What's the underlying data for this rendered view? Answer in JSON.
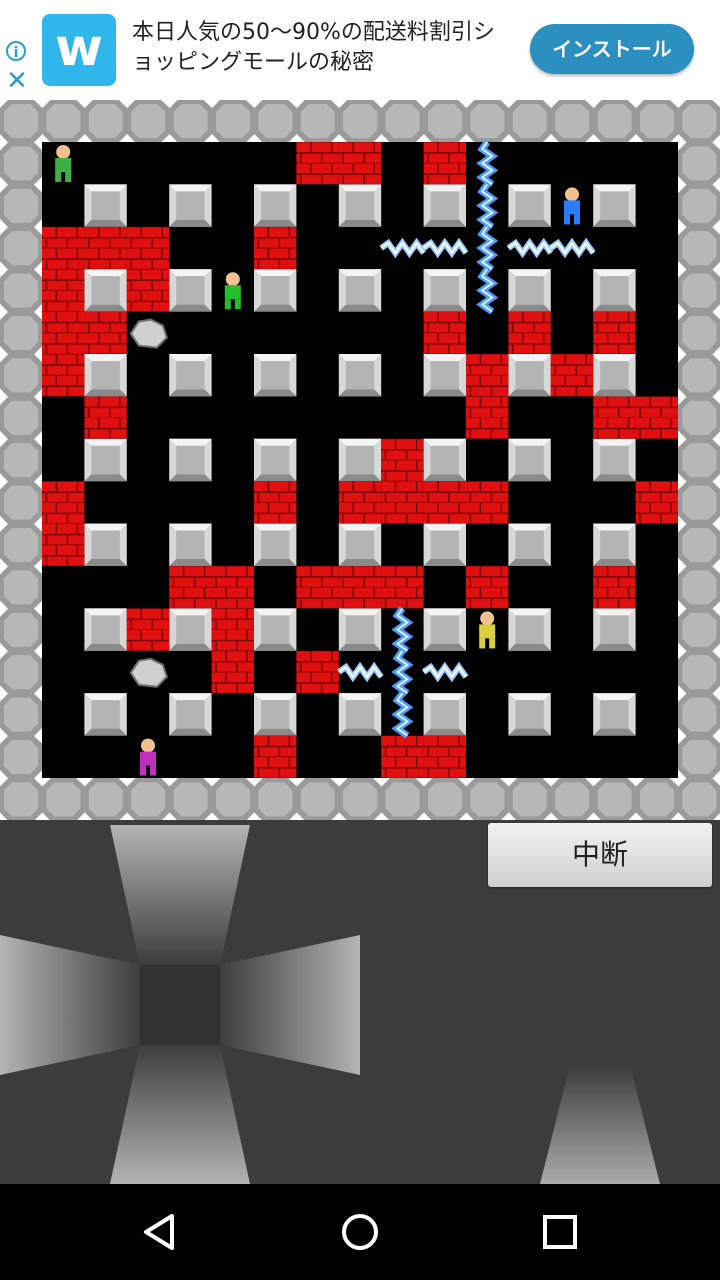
{
  "ad": {
    "text": "本日人気の50〜90%の配送料割引ショッピングモールの秘密",
    "install_label": "インストール",
    "logo_letter": "w",
    "info_glyph": "i",
    "close_glyph": "✕",
    "accent": "#2b8fbf"
  },
  "controls": {
    "pause_label": "中断"
  },
  "game": {
    "grid_cols": 15,
    "grid_rows": 15,
    "colors": {
      "floor": "#000000",
      "brick": "#e01010",
      "pillar": "#b0b0b0",
      "lightning": "#3a8cff"
    },
    "bricks": [
      [
        7,
        1
      ],
      [
        8,
        1
      ],
      [
        10,
        1
      ],
      [
        1,
        3
      ],
      [
        2,
        3
      ],
      [
        3,
        3
      ],
      [
        6,
        3
      ],
      [
        1,
        4
      ],
      [
        3,
        4
      ],
      [
        1,
        5
      ],
      [
        2,
        5
      ],
      [
        10,
        5
      ],
      [
        12,
        5
      ],
      [
        14,
        5
      ],
      [
        1,
        6
      ],
      [
        11,
        6
      ],
      [
        13,
        6
      ],
      [
        2,
        7
      ],
      [
        11,
        7
      ],
      [
        14,
        7
      ],
      [
        15,
        7
      ],
      [
        9,
        8
      ],
      [
        1,
        9
      ],
      [
        6,
        9
      ],
      [
        8,
        9
      ],
      [
        9,
        9
      ],
      [
        10,
        9
      ],
      [
        11,
        9
      ],
      [
        15,
        9
      ],
      [
        1,
        10
      ],
      [
        4,
        11
      ],
      [
        5,
        11
      ],
      [
        7,
        11
      ],
      [
        8,
        11
      ],
      [
        9,
        11
      ],
      [
        11,
        11
      ],
      [
        14,
        11
      ],
      [
        3,
        12
      ],
      [
        5,
        12
      ],
      [
        5,
        13
      ],
      [
        7,
        13
      ],
      [
        6,
        15
      ],
      [
        9,
        15
      ],
      [
        10,
        15
      ]
    ],
    "lightning_h": [
      [
        9,
        3
      ],
      [
        10,
        3
      ],
      [
        12,
        3
      ],
      [
        13,
        3
      ],
      [
        8,
        13
      ],
      [
        10,
        13
      ]
    ],
    "lightning_v": [
      [
        11,
        1
      ],
      [
        11,
        2
      ],
      [
        11,
        3
      ],
      [
        11,
        4
      ],
      [
        9,
        12
      ],
      [
        9,
        13
      ],
      [
        9,
        14
      ]
    ],
    "characters": [
      {
        "name": "player-hero",
        "col": 1,
        "row": 1,
        "color": "#3cb043"
      },
      {
        "name": "ghost-enemy",
        "col": 5,
        "row": 4,
        "color": "#22c02a"
      },
      {
        "name": "blue-warrior-enemy",
        "col": 13,
        "row": 2,
        "color": "#2a7cff"
      },
      {
        "name": "yellow-elf-enemy",
        "col": 11,
        "row": 12,
        "color": "#d8d040"
      },
      {
        "name": "purple-dragon-enemy",
        "col": 3,
        "row": 15,
        "color": "#c030c0"
      }
    ],
    "rocks": [
      [
        3,
        5
      ],
      [
        3,
        13
      ]
    ]
  }
}
